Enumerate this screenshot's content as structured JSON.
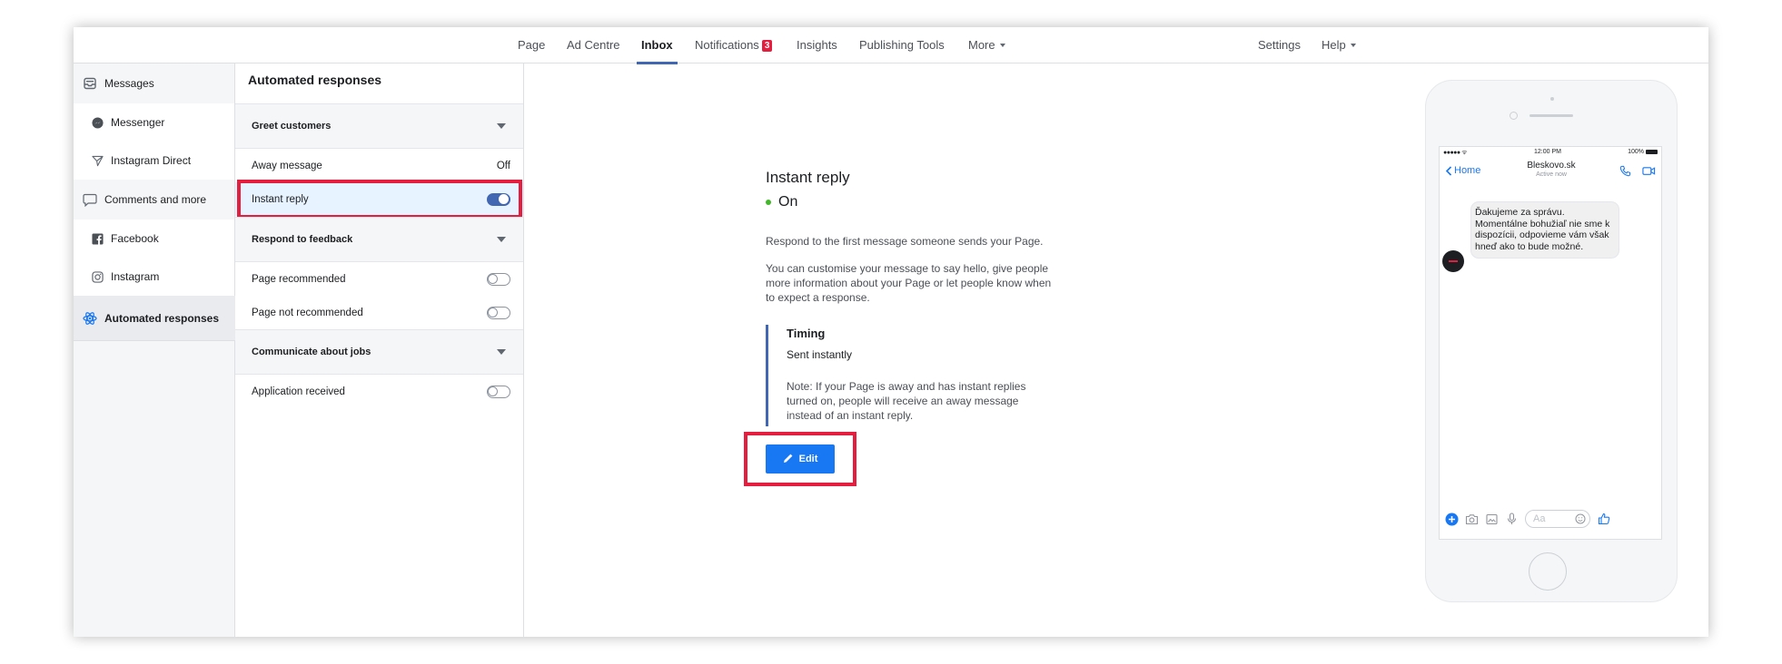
{
  "nav": {
    "page": "Page",
    "ad_centre": "Ad Centre",
    "inbox": "Inbox",
    "notifications": "Notifications",
    "notifications_count": "3",
    "insights": "Insights",
    "publishing_tools": "Publishing Tools",
    "more": "More",
    "settings": "Settings",
    "help": "Help"
  },
  "sidebar": {
    "messages": "Messages",
    "messenger": "Messenger",
    "instagram_direct": "Instagram Direct",
    "comments_and_more": "Comments and more",
    "facebook": "Facebook",
    "instagram": "Instagram",
    "automated_responses": "Automated responses"
  },
  "middle": {
    "title": "Automated responses",
    "sections": [
      {
        "label": "Greet customers"
      },
      {
        "label": "Respond to feedback"
      },
      {
        "label": "Communicate about jobs"
      }
    ],
    "away_message": {
      "label": "Away message",
      "value": "Off"
    },
    "instant_reply": {
      "label": "Instant reply",
      "enabled": true
    },
    "page_recommended": {
      "label": "Page recommended",
      "enabled": false
    },
    "page_not_recommended": {
      "label": "Page not recommended",
      "enabled": false
    },
    "application_received": {
      "label": "Application received",
      "enabled": false
    }
  },
  "content": {
    "title": "Instant reply",
    "status": "On",
    "description1": "Respond to the first message someone sends your Page.",
    "description2": "You can customise your message to say hello, give people more information about your Page or let people know when to expect a response.",
    "timing_label": "Timing",
    "timing_value": "Sent instantly",
    "note": "Note: If your Page is away and has instant replies turned on, people will receive an away message instead of an instant reply.",
    "edit_label": "Edit"
  },
  "phone": {
    "signal": "●●●●● ᯤ",
    "time": "12:00 PM",
    "battery": "100%",
    "back_label": "Home",
    "contact_name": "Bleskovo.sk",
    "contact_status": "Active now",
    "message": "Ďakujeme za správu. Momentálne bohužiaľ nie sme k dispozícii, odpovieme vám však hneď ako to bude možné.",
    "input_placeholder": "Aa"
  },
  "colors": {
    "accent": "#4267b2",
    "button": "#1877f2",
    "highlight": "#e41e3f",
    "status_on": "#42b72a",
    "badge": "#e41e3f"
  }
}
